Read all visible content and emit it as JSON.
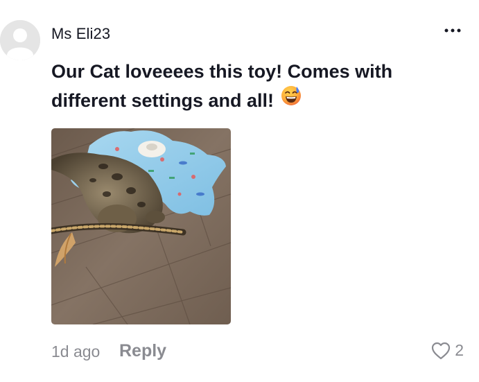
{
  "comment": {
    "username": "Ms Eli23",
    "text": "Our Cat loveeees this toy! Comes with different settings and all!",
    "emoji_icon": "grinning-sweat-emoji",
    "time_ago": "1d ago",
    "reply_label": "Reply",
    "like_count": "2",
    "photo_alt": "Bengal cat playing with a feather wand toy on a blue fish-print mat"
  },
  "icons": {
    "more": "more-horizontal-icon",
    "like": "heart-outline-icon",
    "avatar": "default-avatar-icon"
  },
  "colors": {
    "text_primary": "#161823",
    "text_secondary": "#8a8b91",
    "avatar_bg": "#e5e5e5"
  }
}
